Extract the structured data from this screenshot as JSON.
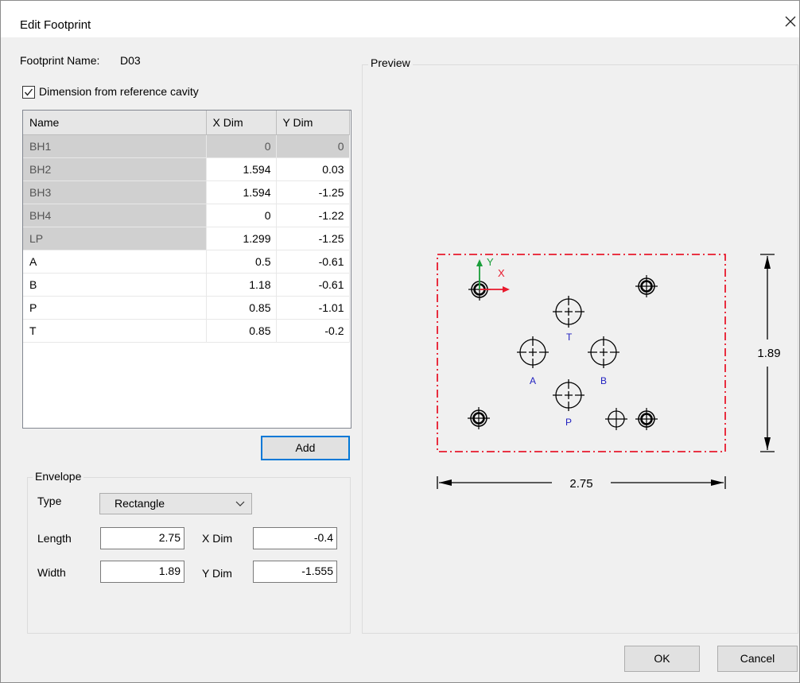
{
  "window": {
    "title": "Edit Footprint"
  },
  "footprint": {
    "name_label": "Footprint Name:",
    "name_value": "D03"
  },
  "checkbox": {
    "label": "Dimension from reference cavity",
    "checked": true
  },
  "grid": {
    "headers": [
      "Name",
      "X Dim",
      "Y Dim"
    ],
    "rows": [
      {
        "name": "BH1",
        "x": "0",
        "y": "0"
      },
      {
        "name": "BH2",
        "x": "1.594",
        "y": "0.03"
      },
      {
        "name": "BH3",
        "x": "1.594",
        "y": "-1.25"
      },
      {
        "name": "BH4",
        "x": "0",
        "y": "-1.22"
      },
      {
        "name": "LP",
        "x": "1.299",
        "y": "-1.25"
      },
      {
        "name": "A",
        "x": "0.5",
        "y": "-0.61"
      },
      {
        "name": "B",
        "x": "1.18",
        "y": "-0.61"
      },
      {
        "name": "P",
        "x": "0.85",
        "y": "-1.01"
      },
      {
        "name": "T",
        "x": "0.85",
        "y": "-0.2"
      }
    ]
  },
  "buttons": {
    "add": "Add",
    "ok": "OK",
    "cancel": "Cancel"
  },
  "envelope": {
    "group_label": "Envelope",
    "type_label": "Type",
    "type_value": "Rectangle",
    "length_label": "Length",
    "length_value": "2.75",
    "width_label": "Width",
    "width_value": "1.89",
    "xdim_label": "X Dim",
    "xdim_value": "-0.4",
    "ydim_label": "Y Dim",
    "ydim_value": "-1.555"
  },
  "preview": {
    "group_label": "Preview",
    "length_dim": "2.75",
    "width_dim": "1.89",
    "axis_x": "X",
    "axis_y": "Y",
    "cavity_labels": {
      "A": "A",
      "B": "B",
      "P": "P",
      "T": "T"
    },
    "colors": {
      "envelope": "#e8192c",
      "axis_x": "#e8192c",
      "axis_y": "#1a9e3a",
      "cavity_label": "#2020c0"
    }
  }
}
